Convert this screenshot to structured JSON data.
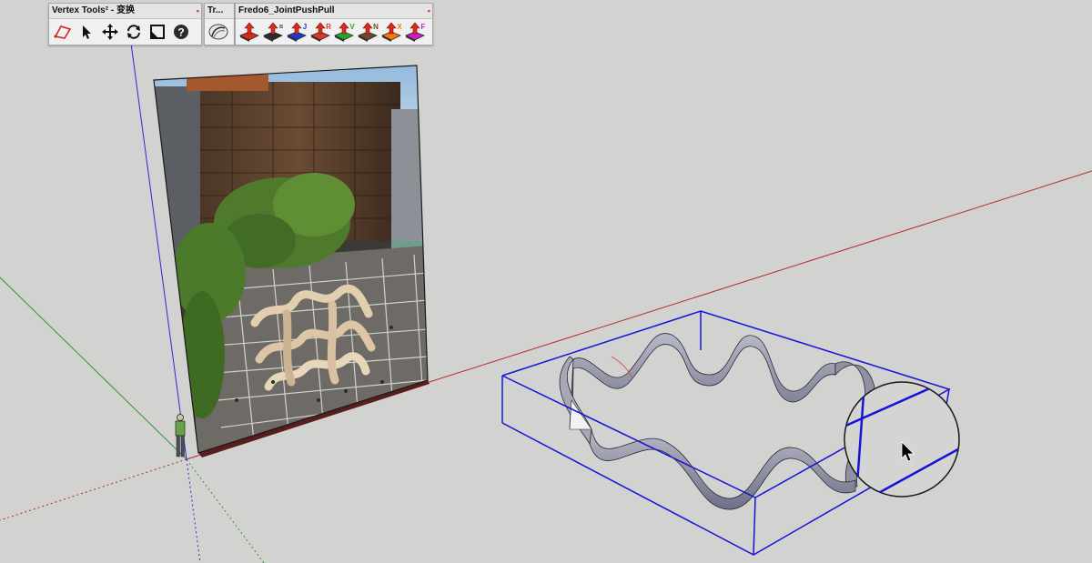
{
  "toolbars": [
    {
      "title": "Vertex Tools² - 变换",
      "tools": [
        "select-polygon-icon",
        "pointer-icon",
        "move-icon",
        "rotate-icon",
        "scale-icon",
        "help-icon"
      ]
    },
    {
      "title": "Tr...",
      "tools": [
        "curve-tool-icon"
      ]
    },
    {
      "title": "Fredo6_JointPushPull",
      "tools": [
        "joint-push-pull-icon",
        "push-pull-equal-icon",
        "push-pull-j-icon",
        "push-pull-r-icon",
        "push-pull-v-icon",
        "push-pull-n-icon",
        "push-pull-x-icon",
        "push-pull-f-icon"
      ],
      "letters": [
        "",
        "=",
        "J",
        "R",
        "V",
        "N",
        "X",
        "F"
      ],
      "colors": [
        "#d62c1a",
        "#2b2b2b",
        "#1f39c7",
        "#d8392a",
        "#22a62b",
        "#6b4a2a",
        "#f07a10",
        "#c71fc7"
      ]
    }
  ],
  "colors": {
    "background": "#d2d2d0",
    "red_axis": "#b32a2a",
    "green_axis": "#2e9c2e",
    "blue_axis": "#2a2ad8",
    "selection": "#1414d8"
  }
}
